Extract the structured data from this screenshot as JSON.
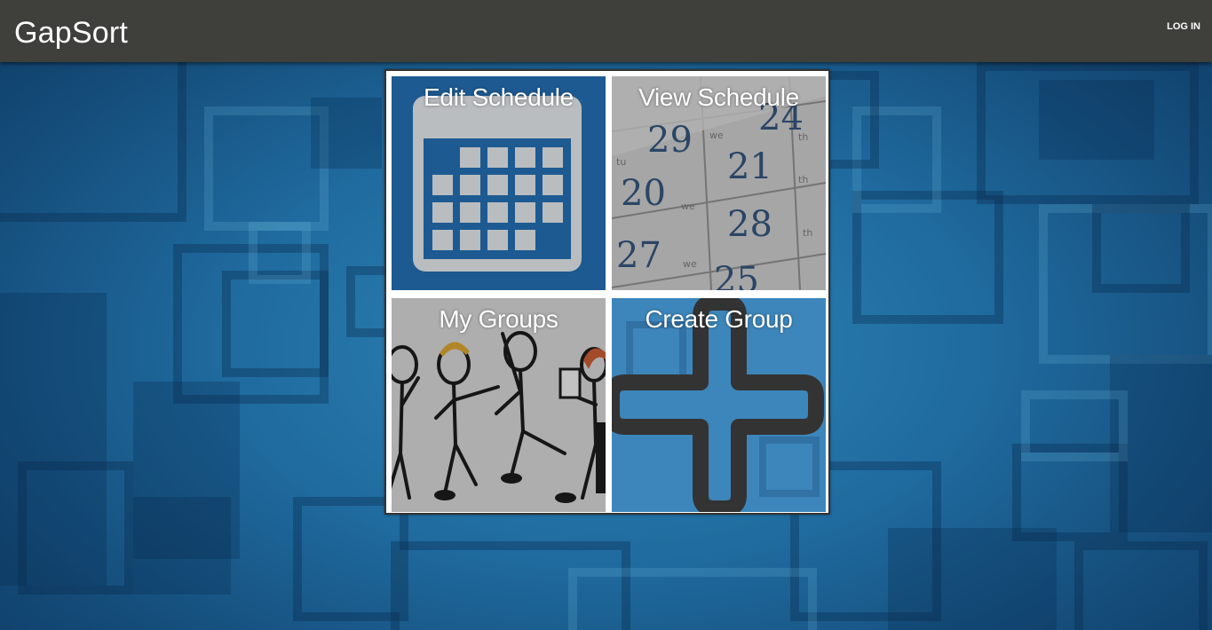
{
  "app": {
    "brand": "GapSort",
    "login_label": "LOG IN"
  },
  "tiles": [
    {
      "label": "Edit Schedule",
      "icon": "calendar-icon"
    },
    {
      "label": "View Schedule",
      "icon": "calendar-photo"
    },
    {
      "label": "My Groups",
      "icon": "stick-figures-image"
    },
    {
      "label": "Create Group",
      "icon": "plus-icon"
    }
  ],
  "calendar_photo_numbers": [
    "29",
    "21",
    "28",
    "27",
    "20",
    "25",
    "24"
  ],
  "calendar_photo_day_marks": [
    "we",
    "we",
    "we",
    "th",
    "th",
    "th",
    "tu"
  ],
  "colors": {
    "topbar": "#3f3f3b",
    "tile_blue": "#1d5a92",
    "background_blue": "#1f6a9e"
  }
}
